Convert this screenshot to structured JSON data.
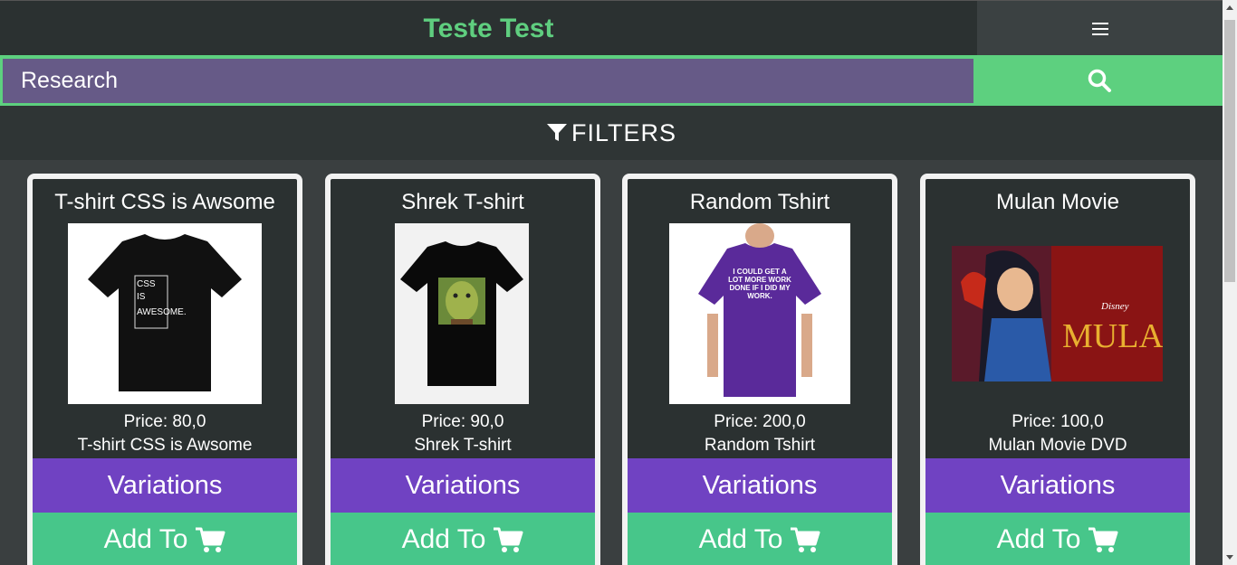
{
  "header": {
    "brand": "Teste Test",
    "menu_icon": "hamburger-menu-icon"
  },
  "search": {
    "placeholder": "Research",
    "button_icon": "search-icon"
  },
  "filters": {
    "label": "FILTERS",
    "icon": "funnel-icon"
  },
  "colors": {
    "brand_green": "#5fce7f",
    "search_purple": "#665a87",
    "variations_purple": "#7042c2",
    "add_green": "#47c68a",
    "dark_bg": "#2b3131"
  },
  "products": [
    {
      "title": "T-shirt CSS is Awsome",
      "price": "Price: 80,0",
      "description": "T-shirt CSS is Awsome",
      "variations_label": "Variations",
      "add_label": "Add To",
      "image_text": [
        "CSS",
        "IS",
        "AWESOME."
      ]
    },
    {
      "title": "Shrek T-shirt",
      "price": "Price: 90,0",
      "description": "Shrek T-shirt",
      "variations_label": "Variations",
      "add_label": "Add To"
    },
    {
      "title": "Random Tshirt",
      "price": "Price: 200,0",
      "description": "Random Tshirt",
      "variations_label": "Variations",
      "add_label": "Add To",
      "image_text": [
        "I COULD GET A",
        "LOT MORE WORK",
        "DONE IF I DID MY",
        "WORK."
      ]
    },
    {
      "title": "Mulan Movie",
      "price": "Price: 100,0",
      "description": "Mulan Movie DVD",
      "variations_label": "Variations",
      "add_label": "Add To",
      "image_text": [
        "Disney",
        "MULAN"
      ]
    }
  ]
}
